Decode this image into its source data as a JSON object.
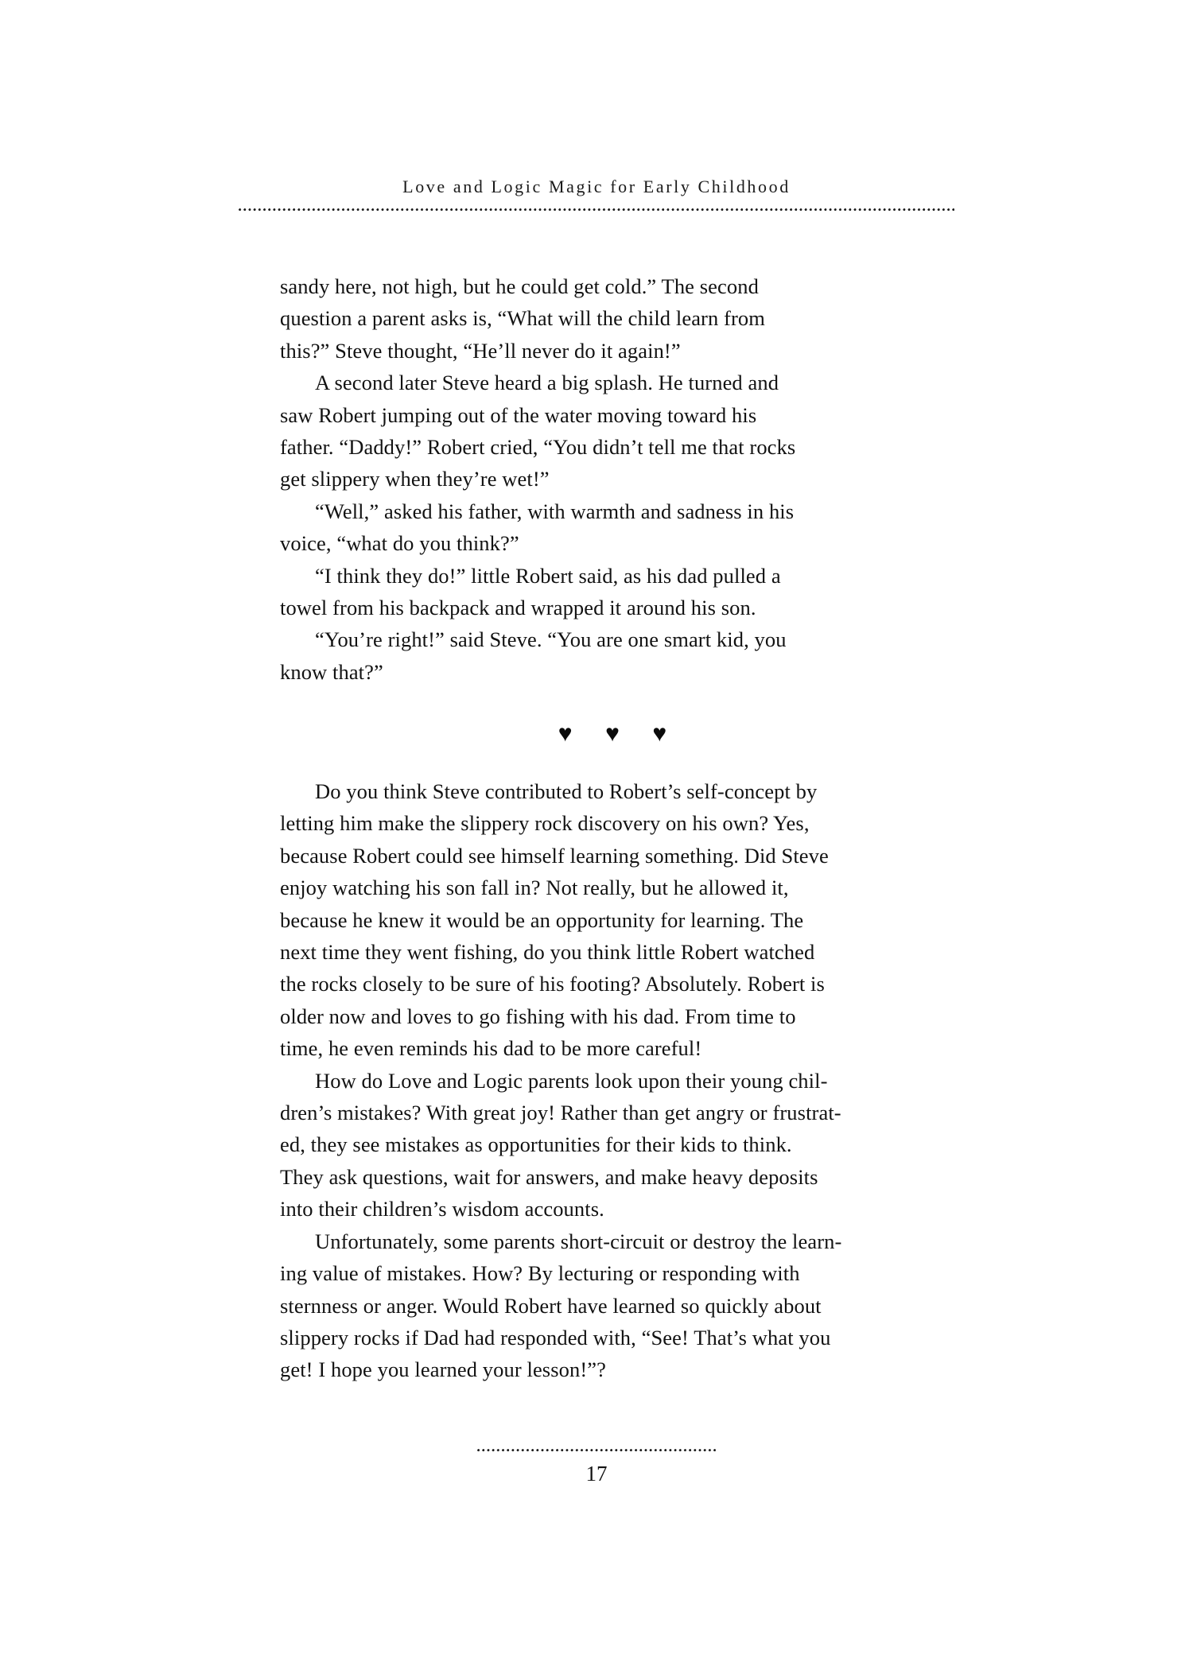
{
  "page": {
    "running_head": "Love and Logic Magic for Early Childhood",
    "page_number": "17",
    "ornament": "♥ ♥ ♥"
  },
  "body_upper": {
    "lines": [
      {
        "text": "sandy here, not high, but he could get cold.” The second",
        "indent": false
      },
      {
        "text": "question a parent asks is, “What will the child learn from",
        "indent": false
      },
      {
        "text": "this?” Steve thought, “He’ll never do it again!”",
        "indent": false
      },
      {
        "text": "A second later Steve heard a big splash. He turned and",
        "indent": true
      },
      {
        "text": "saw Robert jumping out of the water moving toward his",
        "indent": false
      },
      {
        "text": "father. “Daddy!” Robert cried, “You didn’t tell me that rocks",
        "indent": false
      },
      {
        "text": "get slippery when they’re wet!”",
        "indent": false
      },
      {
        "text": "“Well,” asked his father, with warmth and sadness in his",
        "indent": true
      },
      {
        "text": "voice, “what do you think?”",
        "indent": false
      },
      {
        "text": "“I think they do!” little Robert said, as his dad pulled a",
        "indent": true
      },
      {
        "text": "towel from his backpack and wrapped it around his son.",
        "indent": false
      },
      {
        "text": "“You’re right!” said Steve. “You are one smart kid, you",
        "indent": true
      },
      {
        "text": "know that?”",
        "indent": false
      }
    ]
  },
  "body_lower": {
    "lines": [
      {
        "text": "Do you think Steve contributed to Robert’s self-concept by",
        "indent": true
      },
      {
        "text": "letting him make the slippery rock discovery on his own? Yes,",
        "indent": false
      },
      {
        "text": "because Robert could see himself learning something. Did Steve",
        "indent": false
      },
      {
        "text": "enjoy watching his son fall in? Not really, but he allowed it,",
        "indent": false
      },
      {
        "text": "because he knew it would be an opportunity for learning. The",
        "indent": false
      },
      {
        "text": "next time they went fishing, do you think little Robert watched",
        "indent": false
      },
      {
        "text": "the rocks closely to be sure of his footing? Absolutely. Robert is",
        "indent": false
      },
      {
        "text": "older now and loves to go fishing with his dad. From time to",
        "indent": false
      },
      {
        "text": "time, he even reminds his dad to be more careful!",
        "indent": false
      },
      {
        "text": "How do Love and Logic parents look upon their young chil-",
        "indent": true
      },
      {
        "text": "dren’s mistakes? With great joy! Rather than get angry or frustrat-",
        "indent": false
      },
      {
        "text": "ed, they see mistakes as opportunities for their kids to think.",
        "indent": false
      },
      {
        "text": "They ask questions, wait for answers, and make heavy deposits",
        "indent": false
      },
      {
        "text": "into their children’s wisdom accounts.",
        "indent": false
      },
      {
        "text": "Unfortunately, some parents short-circuit or destroy the learn-",
        "indent": true
      },
      {
        "text": "ing value of mistakes. How? By lecturing or responding with",
        "indent": false
      },
      {
        "text": "sternness or anger. Would Robert have learned so quickly about",
        "indent": false
      },
      {
        "text": "slippery rocks if Dad had responded with, “See! That’s what you",
        "indent": false
      },
      {
        "text": "get! I hope you learned your lesson!”?",
        "indent": false
      }
    ]
  }
}
